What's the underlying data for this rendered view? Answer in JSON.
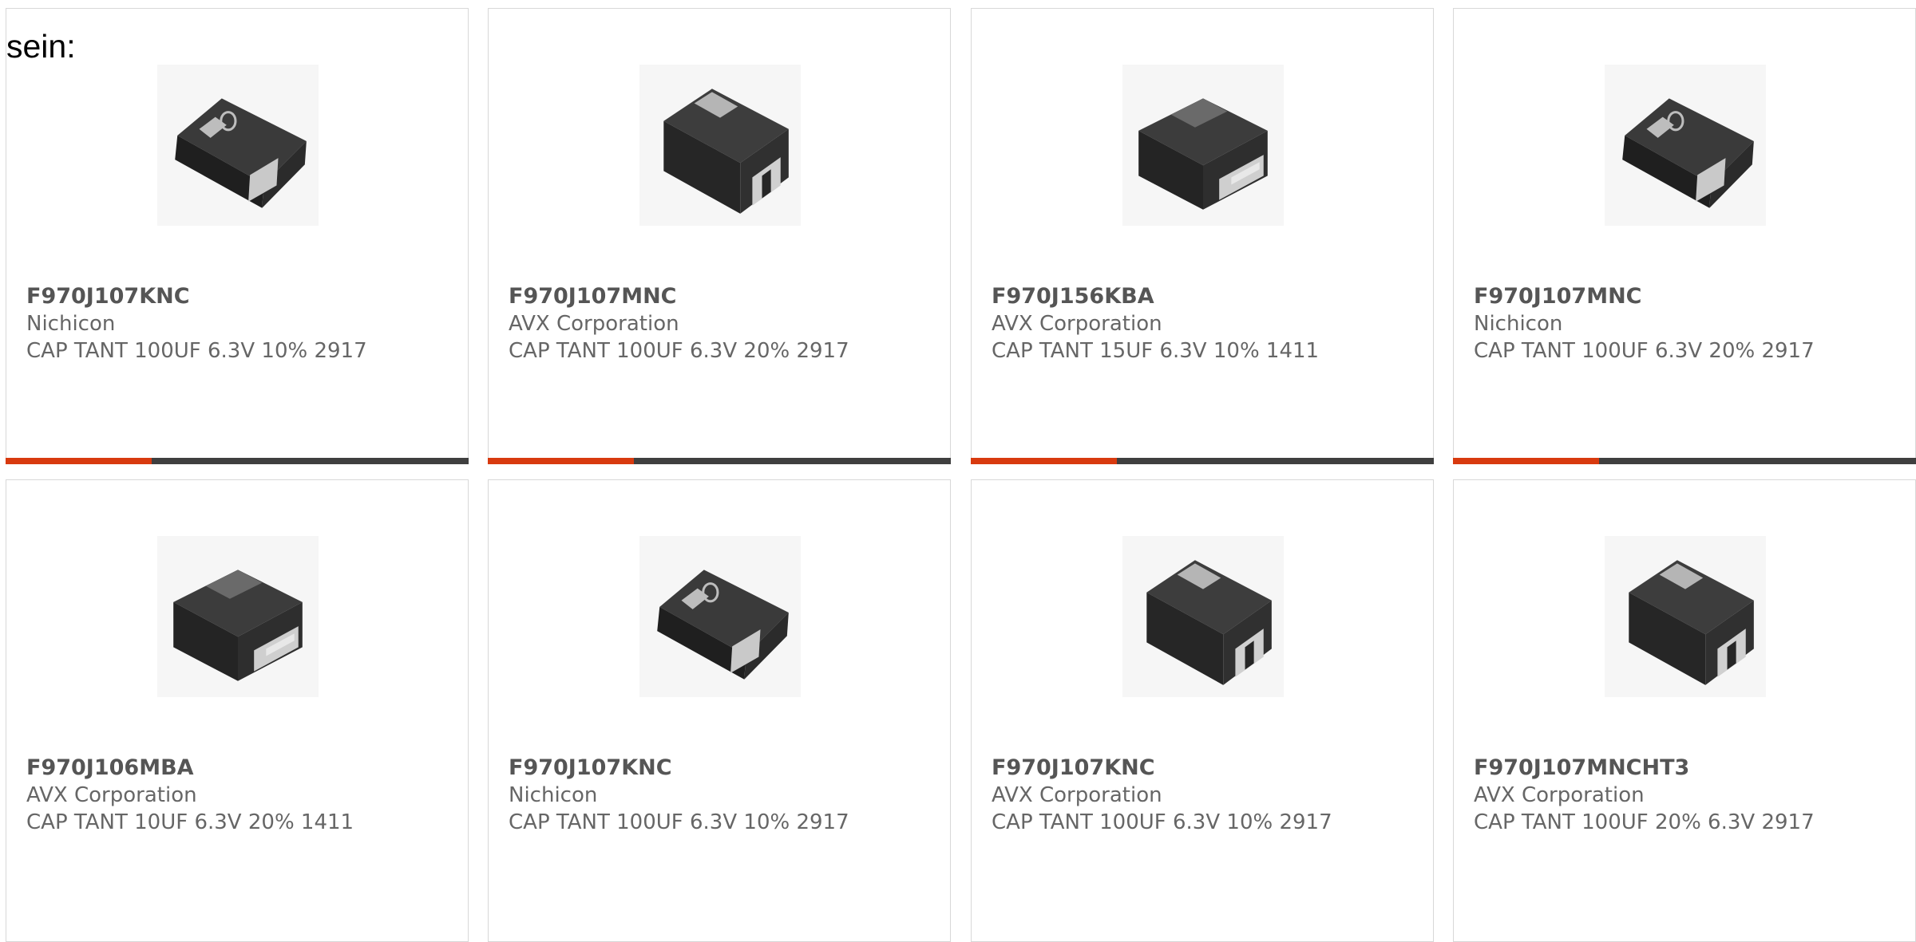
{
  "lead_text": "sein:",
  "colors": {
    "accent": "#d83a0f",
    "bar_track": "#3f3f3f",
    "text": "#666666",
    "border": "#d8d8d8"
  },
  "products": [
    {
      "part_number": "F970J107KNC",
      "manufacturer": "Nichicon",
      "description": "CAP TANT 100UF 6.3V 10% 2917",
      "image": "tantalum-capacitor-logo-tilted-icon"
    },
    {
      "part_number": "F970J107MNC",
      "manufacturer": "AVX Corporation",
      "description": "CAP TANT 100UF 6.3V 20% 2917",
      "image": "tantalum-capacitor-front-icon"
    },
    {
      "part_number": "F970J156KBA",
      "manufacturer": "AVX Corporation",
      "description": "CAP TANT 15UF 6.3V 10% 1411",
      "image": "tantalum-capacitor-side-icon"
    },
    {
      "part_number": "F970J107MNC",
      "manufacturer": "Nichicon",
      "description": "CAP TANT 100UF 6.3V 20% 2917",
      "image": "tantalum-capacitor-logo-tilted-icon"
    },
    {
      "part_number": "F970J106MBA",
      "manufacturer": "AVX Corporation",
      "description": "CAP TANT 10UF 6.3V 20% 1411",
      "image": "tantalum-capacitor-side-icon"
    },
    {
      "part_number": "F970J107KNC",
      "manufacturer": "Nichicon",
      "description": "CAP TANT 100UF 6.3V 10% 2917",
      "image": "tantalum-capacitor-logo-tilted-icon"
    },
    {
      "part_number": "F970J107KNC",
      "manufacturer": "AVX Corporation",
      "description": "CAP TANT 100UF 6.3V 10% 2917",
      "image": "tantalum-capacitor-front-icon"
    },
    {
      "part_number": "F970J107MNCHT3",
      "manufacturer": "AVX Corporation",
      "description": "CAP TANT 100UF 20% 6.3V 2917",
      "image": "tantalum-capacitor-front-icon"
    }
  ]
}
